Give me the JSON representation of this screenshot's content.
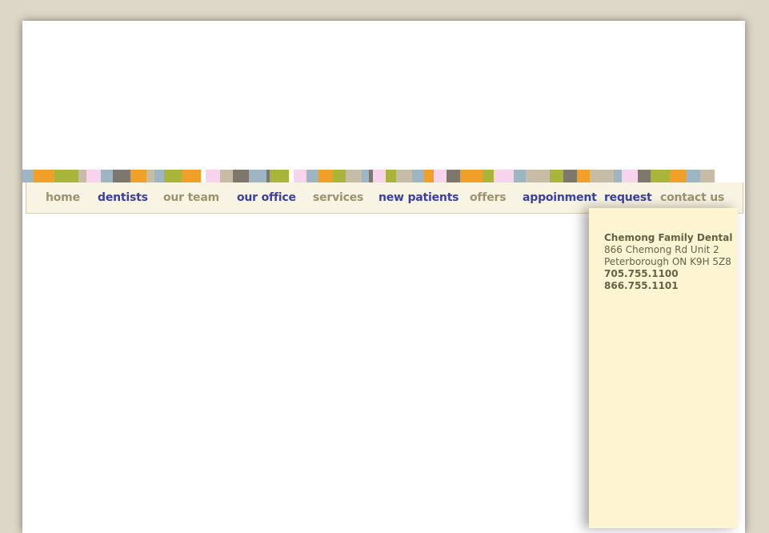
{
  "colors": {
    "background": "#ddd7c7",
    "nav_bar": "#f8f4e3",
    "nav_tan": "#9c9270",
    "nav_blue": "#3c3ea8",
    "sidebar": "#fdf5d1",
    "address_text": "#6a5f45"
  },
  "stripe_colors": [
    "#9eb5c4",
    "#f0a028",
    "#a9b53a",
    "#c7bca6",
    "#f7d4ec",
    "#9eb5c4",
    "#7e776c",
    "#f0a028",
    "#c7bca6",
    "#9eb5c4",
    "#a9b53a",
    "#f0a028",
    "#ffffff",
    "#f7d4ec",
    "#c7bca6",
    "#7e776c",
    "#9eb5c4",
    "#7e776c",
    "#a9b53a",
    "#ffffff",
    "#f7d4ec",
    "#9eb5c4",
    "#f0a028",
    "#a9b53a",
    "#c7bca6",
    "#9eb5c4",
    "#7e776c",
    "#f7d4ec",
    "#a9b53a",
    "#c7bca6",
    "#9eb5c4",
    "#f0a028",
    "#f7d4ec",
    "#7e776c",
    "#f0a028",
    "#a9b53a",
    "#f7d4ec",
    "#9eb5c4",
    "#c7bca6",
    "#a9b53a",
    "#7e776c",
    "#f0a028",
    "#c7bca6",
    "#9eb5c4",
    "#f7d4ec",
    "#7e776c",
    "#a9b53a",
    "#f0a028",
    "#9eb5c4",
    "#c7bca6"
  ],
  "nav": {
    "home": "home",
    "dentists": "dentists",
    "our_team": "our team",
    "our_office": "our office",
    "services": "services",
    "new_patients": "new patients",
    "offers": "offers",
    "appointment_request": "appoinment  request",
    "contact_us": "contact us"
  },
  "contact": {
    "name": "Chemong Family Dental",
    "street": "866 Chemong Rd Unit 2",
    "city": "Peterborough ON K9H 5Z8",
    "phone": "705.755.1100",
    "toll_free": "866.755.1101"
  }
}
